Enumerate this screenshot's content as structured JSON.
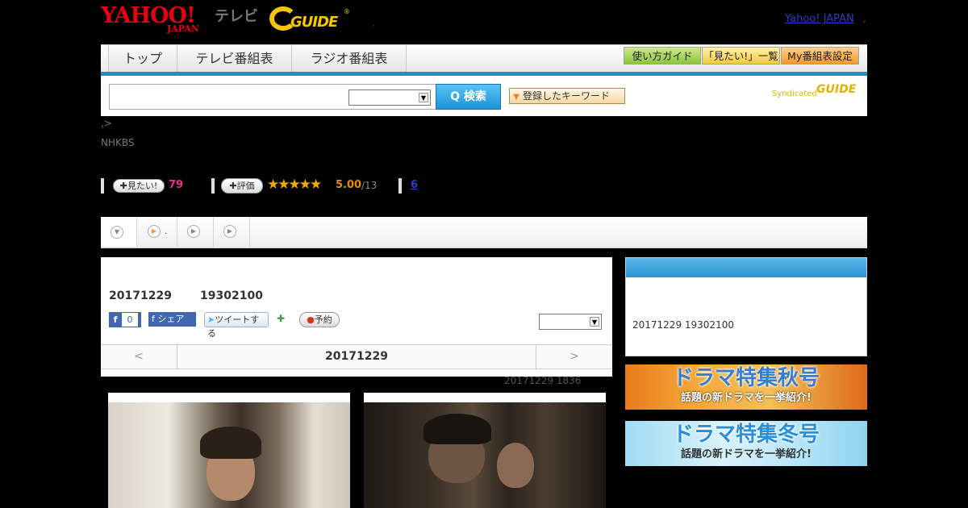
{
  "header": {
    "yahoo_logo": "YAHOO!",
    "yahoo_sub": "JAPAN",
    "tv_label": "テレビ",
    "gguide_logo": "GUIDE",
    "gguide_reg": "®",
    "dot": ",",
    "yahoo_japan_link": "Yahoo! JAPAN",
    "link_sep": ","
  },
  "nav": {
    "tabs": [
      "トップ",
      "テレビ番組表",
      "ラジオ番組表"
    ],
    "util": [
      "使い方ガイド",
      "「見たい!」一覧",
      "My番組表設定"
    ]
  },
  "search": {
    "button": "Q 検索",
    "keyword_button": "登録したキーワード",
    "syndicated": "Syndicated",
    "syndicated_logo": "GUIDE"
  },
  "breadcrumb": ",>",
  "channel": "NHKBS",
  "stats": {
    "mitai_label": "見たい!",
    "mitai_count": "79",
    "hyoka_label": "評価",
    "stars": "★★★★★",
    "score": "5.00",
    "score_total": "/13",
    "count": "6"
  },
  "tabs_strip": {
    "tab2_label": "."
  },
  "program": {
    "date": "20171229",
    "time": "19302100",
    "fb_count": "0",
    "fb_share": "シェア",
    "tweet": "ツイートする",
    "yoyaku": "予約",
    "prev": "<",
    "nav_date": "20171229",
    "next": ">",
    "updated": "20171229  1836"
  },
  "right": {
    "text": "20171229  19302100",
    "banner_autumn_title": "ドラマ特集秋号",
    "banner_autumn_sub": "話題の新ドラマを一挙紹介!",
    "banner_winter_title": "ドラマ特集冬号",
    "banner_winter_sub": "話題の新ドラマを一挙紹介!"
  },
  "colors": {
    "accent_blue": "#1a8fd6",
    "yahoo_red": "#e60012",
    "gguide_yellow": "#f7c600",
    "mitai_pink": "#e8338a"
  }
}
